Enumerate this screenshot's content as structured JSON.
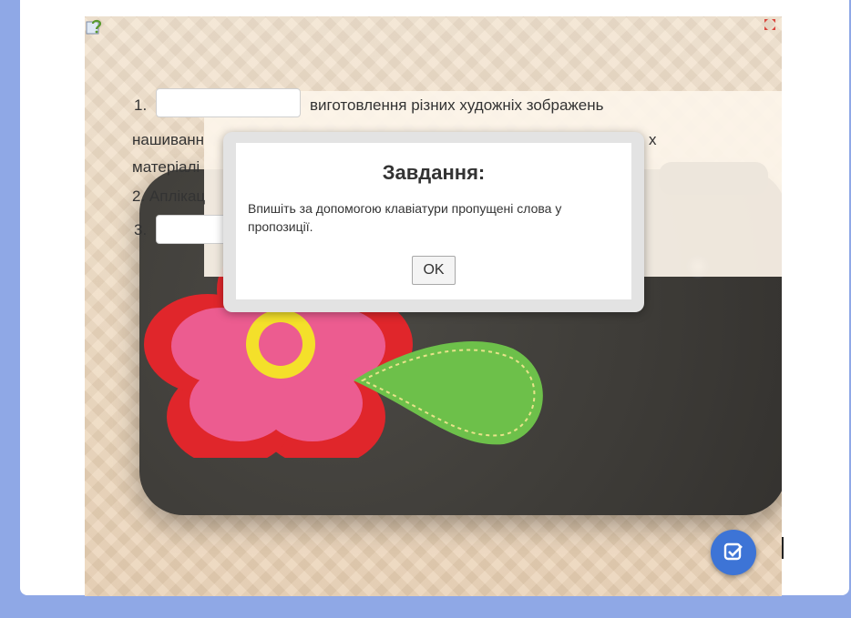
{
  "task": {
    "line1_prefix": "1.",
    "line1_text": "виготовлення різних художніх зображень",
    "line2_visible": "нашиванн",
    "line2_right": "х",
    "line3_visible": "матеріалі",
    "line4_text": "2. Аплікац",
    "line5_prefix": "3."
  },
  "dialog": {
    "title": "Завдання:",
    "message": "Впишіть за допомогою клавіатури пропущені слова у пропозиції.",
    "ok_label": "OK"
  },
  "icons": {
    "help": "help-question-icon",
    "fullscreen": "fullscreen-icon",
    "check": "check-icon"
  },
  "colors": {
    "accent": "#3d74d6",
    "page_border": "#8fa8e6"
  }
}
